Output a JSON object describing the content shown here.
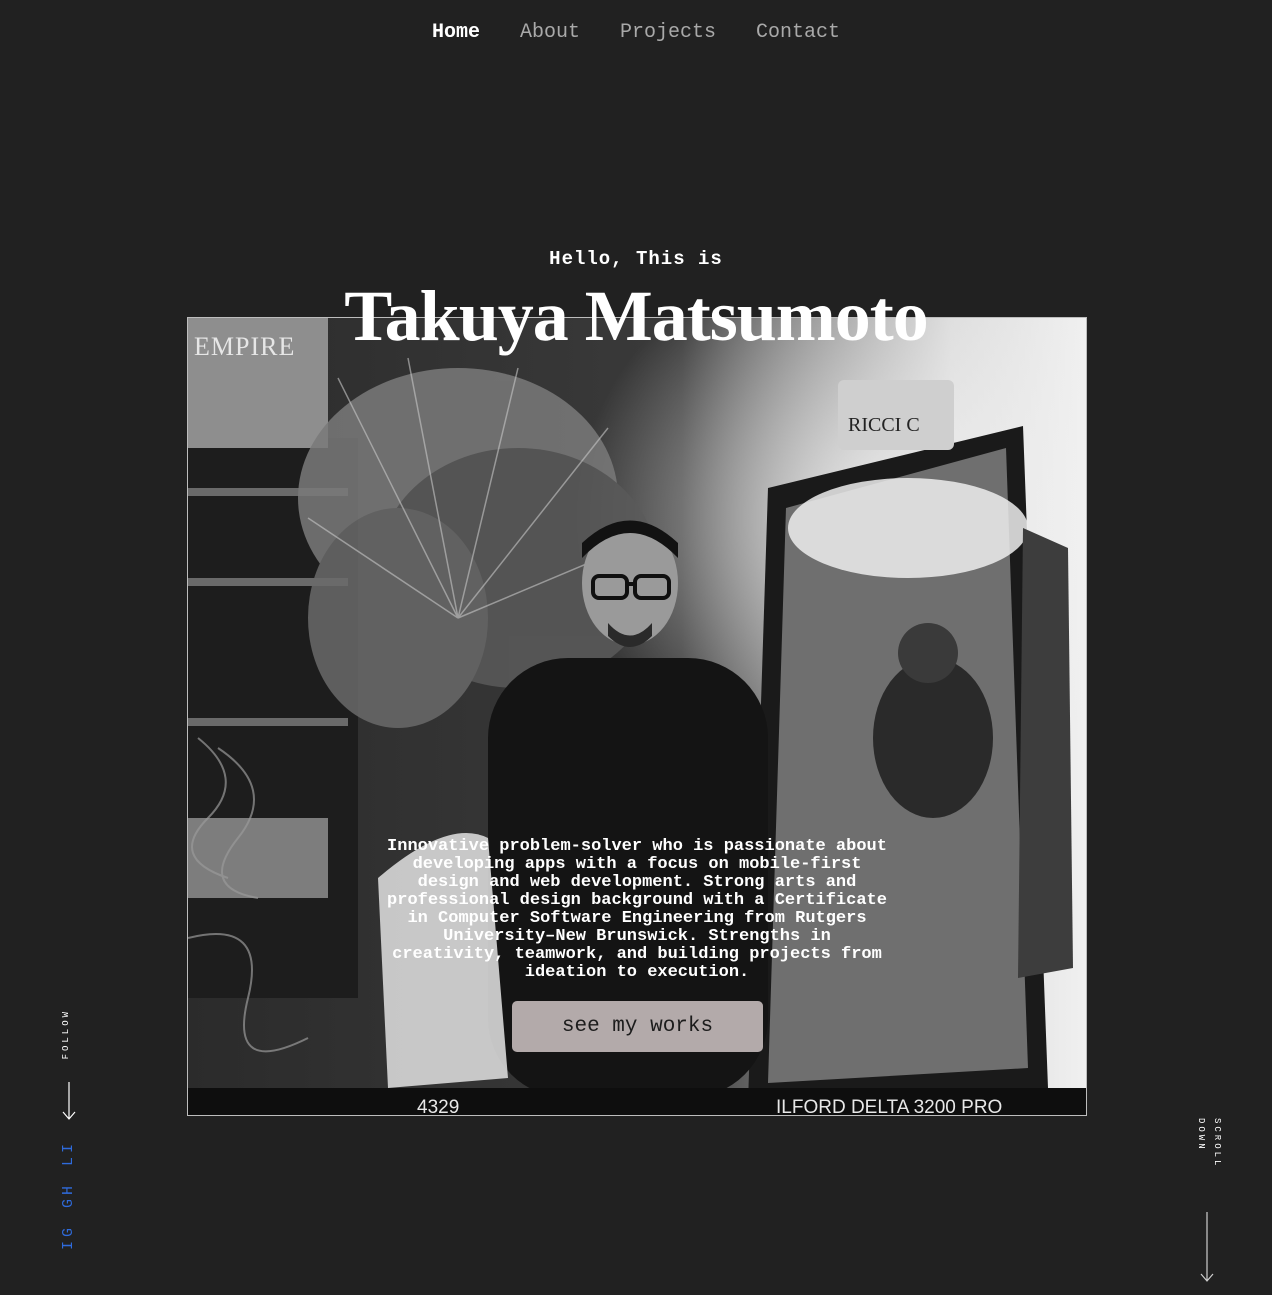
{
  "nav": {
    "items": [
      {
        "label": "Home",
        "active": true
      },
      {
        "label": "About",
        "active": false
      },
      {
        "label": "Projects",
        "active": false
      },
      {
        "label": "Contact",
        "active": false
      }
    ]
  },
  "hero": {
    "greeting": "Hello, This is",
    "name": "Takuya Matsumoto",
    "bio": "Innovative problem-solver who is passionate about developing apps with a focus on mobile-first design and web development. Strong arts and professional design background with a Certificate in Computer Software Engineering from Rutgers University–New Brunswick. Strengths in creativity, teamwork, and building projects from ideation to execution.",
    "cta_label": "see my works",
    "film_frame_number": "4329",
    "film_brand": "ILFORD DELTA 3200 PRO",
    "sign_text": "EMPIRE",
    "plate_text": "RICCI C"
  },
  "follow": {
    "label": "FOLLOW",
    "links": [
      {
        "label": "IG",
        "icon": "instagram-link"
      },
      {
        "label": "GH",
        "icon": "github-link"
      },
      {
        "label": "LI",
        "icon": "linkedin-link"
      }
    ]
  },
  "scroll": {
    "label_line1": "SCROLL",
    "label_line2": "DOWN"
  },
  "colors": {
    "background": "#212121",
    "button": "#b3aaaa",
    "social_link": "#2f6bdc",
    "nav_inactive": "#a9a9a9"
  }
}
